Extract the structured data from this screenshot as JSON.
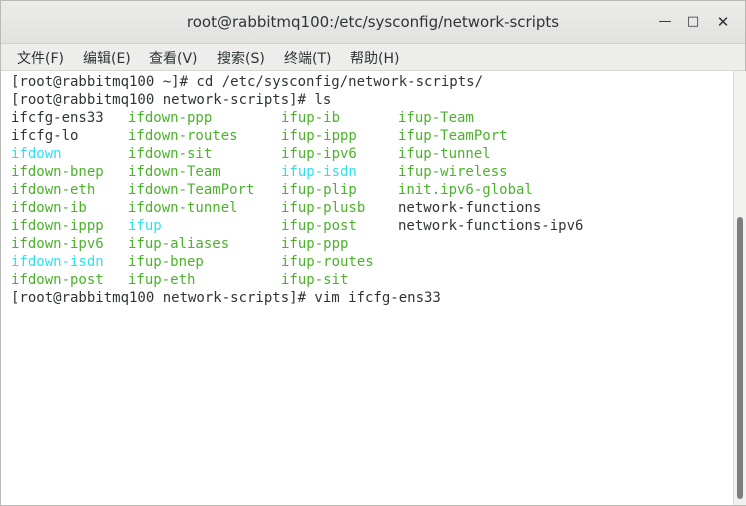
{
  "window": {
    "title": "root@rabbitmq100:/etc/sysconfig/network-scripts",
    "btn_min": "—",
    "btn_max": "□",
    "btn_close": "✕"
  },
  "menu": [
    {
      "label": "文件(F)"
    },
    {
      "label": "编辑(E)"
    },
    {
      "label": "查看(V)"
    },
    {
      "label": "搜索(S)"
    },
    {
      "label": "终端(T)"
    },
    {
      "label": "帮助(H)"
    }
  ],
  "colors": {
    "text": "#2e3436",
    "green": "#4cb22c",
    "cyan": "#2ee0f0"
  },
  "terminal": {
    "lines": [
      "[root@rabbitmq100 ~]# cd /etc/sysconfig/network-scripts/",
      "[root@rabbitmq100 network-scripts]# ls"
    ],
    "ls_rows": [
      [
        {
          "t": "ifcfg-ens33",
          "c": "text"
        },
        {
          "t": "ifdown-ppp",
          "c": "green"
        },
        {
          "t": "ifup-ib",
          "c": "green"
        },
        {
          "t": "ifup-Team",
          "c": "green"
        }
      ],
      [
        {
          "t": "ifcfg-lo",
          "c": "text"
        },
        {
          "t": "ifdown-routes",
          "c": "green"
        },
        {
          "t": "ifup-ippp",
          "c": "green"
        },
        {
          "t": "ifup-TeamPort",
          "c": "green"
        }
      ],
      [
        {
          "t": "ifdown",
          "c": "cyan"
        },
        {
          "t": "ifdown-sit",
          "c": "green"
        },
        {
          "t": "ifup-ipv6",
          "c": "green"
        },
        {
          "t": "ifup-tunnel",
          "c": "green"
        }
      ],
      [
        {
          "t": "ifdown-bnep",
          "c": "green"
        },
        {
          "t": "ifdown-Team",
          "c": "green"
        },
        {
          "t": "ifup-isdn",
          "c": "cyan"
        },
        {
          "t": "ifup-wireless",
          "c": "green"
        }
      ],
      [
        {
          "t": "ifdown-eth",
          "c": "green"
        },
        {
          "t": "ifdown-TeamPort",
          "c": "green"
        },
        {
          "t": "ifup-plip",
          "c": "green"
        },
        {
          "t": "init.ipv6-global",
          "c": "green"
        }
      ],
      [
        {
          "t": "ifdown-ib",
          "c": "green"
        },
        {
          "t": "ifdown-tunnel",
          "c": "green"
        },
        {
          "t": "ifup-plusb",
          "c": "green"
        },
        {
          "t": "network-functions",
          "c": "text"
        }
      ],
      [
        {
          "t": "ifdown-ippp",
          "c": "green"
        },
        {
          "t": "ifup",
          "c": "cyan"
        },
        {
          "t": "ifup-post",
          "c": "green"
        },
        {
          "t": "network-functions-ipv6",
          "c": "text"
        }
      ],
      [
        {
          "t": "ifdown-ipv6",
          "c": "green"
        },
        {
          "t": "ifup-aliases",
          "c": "green"
        },
        {
          "t": "ifup-ppp",
          "c": "green"
        },
        {
          "t": "",
          "c": "text"
        }
      ],
      [
        {
          "t": "ifdown-isdn",
          "c": "cyan"
        },
        {
          "t": "ifup-bnep",
          "c": "green"
        },
        {
          "t": "ifup-routes",
          "c": "green"
        },
        {
          "t": "",
          "c": "text"
        }
      ],
      [
        {
          "t": "ifdown-post",
          "c": "green"
        },
        {
          "t": "ifup-eth",
          "c": "green"
        },
        {
          "t": "ifup-sit",
          "c": "green"
        },
        {
          "t": "",
          "c": "text"
        }
      ]
    ],
    "last_line": "[root@rabbitmq100 network-scripts]# vim ifcfg-ens33"
  }
}
